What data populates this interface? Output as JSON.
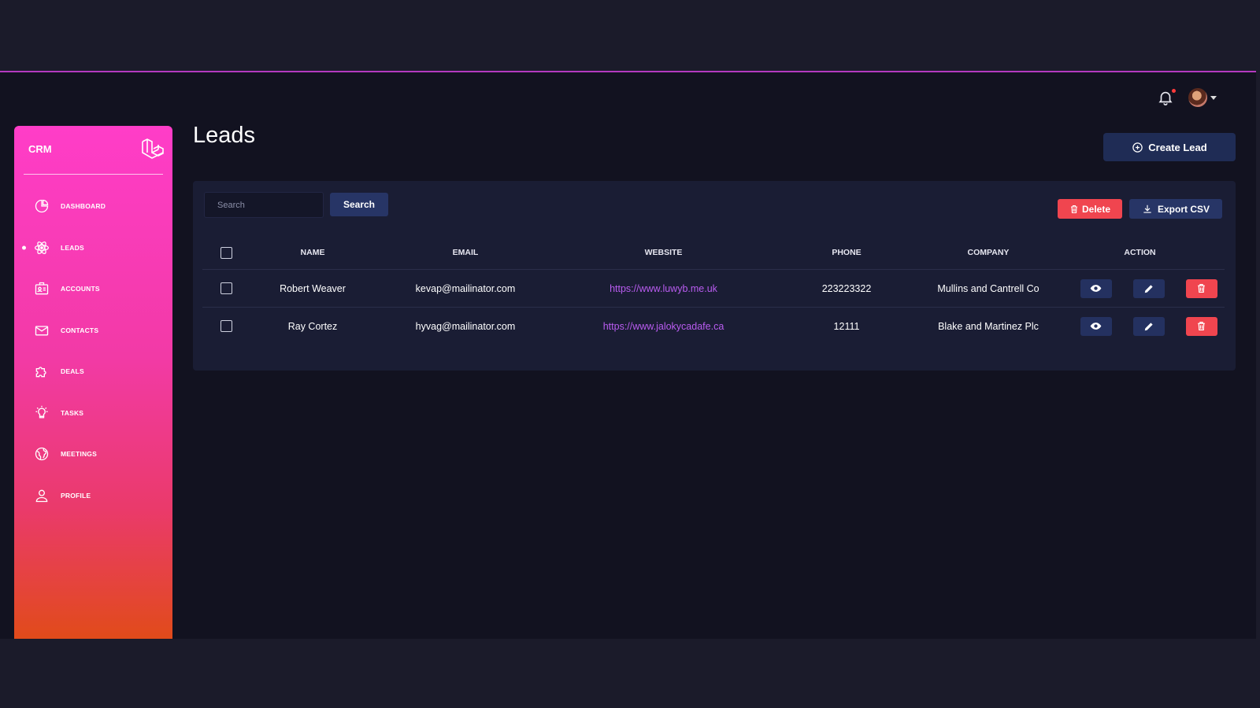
{
  "sidebar": {
    "brand": "CRM",
    "items": [
      {
        "label": "DASHBOARD",
        "icon": "chart-pie-icon"
      },
      {
        "label": "LEADS",
        "icon": "atom-icon",
        "active": true
      },
      {
        "label": "ACCOUNTS",
        "icon": "id-card-icon"
      },
      {
        "label": "CONTACTS",
        "icon": "envelope-icon"
      },
      {
        "label": "DEALS",
        "icon": "puzzle-icon"
      },
      {
        "label": "TASKS",
        "icon": "lightbulb-icon"
      },
      {
        "label": "MEETINGS",
        "icon": "globe-icon"
      },
      {
        "label": "PROFILE",
        "icon": "user-icon"
      }
    ]
  },
  "header": {
    "title": "Leads",
    "create_label": "Create Lead"
  },
  "toolbar": {
    "search_placeholder": "Search",
    "search_label": "Search",
    "delete_label": "Delete",
    "export_label": "Export CSV"
  },
  "table": {
    "columns": [
      "NAME",
      "EMAIL",
      "WEBSITE",
      "PHONE",
      "COMPANY",
      "ACTION"
    ],
    "rows": [
      {
        "name": "Robert Weaver",
        "email": "kevap@mailinator.com",
        "website": "https://www.luwyb.me.uk",
        "phone": "223223322",
        "company": "Mullins and Cantrell Co"
      },
      {
        "name": "Ray Cortez",
        "email": "hyvag@mailinator.com",
        "website": "https://www.jalokycadafe.ca",
        "phone": "12111",
        "company": "Blake and Martinez Plc"
      }
    ]
  },
  "colors": {
    "accent": "#273566",
    "danger": "#f0454f",
    "link": "#b95cf0",
    "sidebar_top": "#ff3dc8",
    "sidebar_bottom": "#e14b1a"
  }
}
